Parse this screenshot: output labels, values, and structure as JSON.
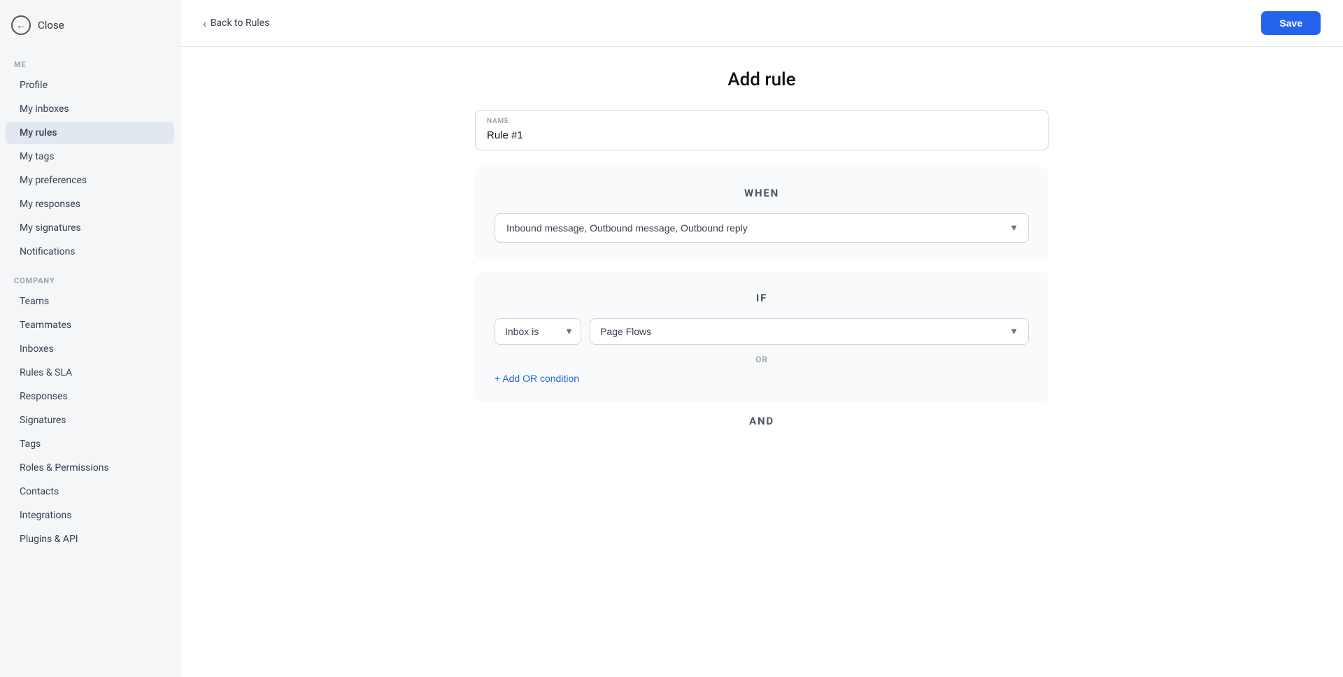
{
  "sidebar": {
    "close_label": "Close",
    "me_section": "ME",
    "company_section": "COMPANY",
    "me_items": [
      {
        "id": "profile",
        "label": "Profile",
        "active": false
      },
      {
        "id": "my-inboxes",
        "label": "My inboxes",
        "active": false
      },
      {
        "id": "my-rules",
        "label": "My rules",
        "active": true
      },
      {
        "id": "my-tags",
        "label": "My tags",
        "active": false
      },
      {
        "id": "my-preferences",
        "label": "My preferences",
        "active": false
      },
      {
        "id": "my-responses",
        "label": "My responses",
        "active": false
      },
      {
        "id": "my-signatures",
        "label": "My signatures",
        "active": false
      },
      {
        "id": "notifications",
        "label": "Notifications",
        "active": false
      }
    ],
    "company_items": [
      {
        "id": "teams",
        "label": "Teams",
        "active": false
      },
      {
        "id": "teammates",
        "label": "Teammates",
        "active": false
      },
      {
        "id": "inboxes",
        "label": "Inboxes",
        "active": false
      },
      {
        "id": "rules-sla",
        "label": "Rules & SLA",
        "active": false
      },
      {
        "id": "responses",
        "label": "Responses",
        "active": false
      },
      {
        "id": "signatures",
        "label": "Signatures",
        "active": false
      },
      {
        "id": "tags",
        "label": "Tags",
        "active": false
      },
      {
        "id": "roles-permissions",
        "label": "Roles & Permissions",
        "active": false
      },
      {
        "id": "contacts",
        "label": "Contacts",
        "active": false
      },
      {
        "id": "integrations",
        "label": "Integrations",
        "active": false
      },
      {
        "id": "plugins-api",
        "label": "Plugins & API",
        "active": false
      }
    ]
  },
  "topbar": {
    "back_label": "Back to Rules",
    "save_label": "Save"
  },
  "main": {
    "page_title": "Add rule",
    "name_label": "NAME",
    "name_placeholder": "Rule #1",
    "name_value": "Rule #1",
    "when_section": {
      "heading": "WHEN",
      "dropdown_value": "Inbound message, Outbound message, Outbound reply",
      "options": [
        "Inbound message, Outbound message, Outbound reply",
        "Inbound message",
        "Outbound message",
        "Outbound reply"
      ]
    },
    "if_section": {
      "heading": "IF",
      "condition_type": "Inbox is",
      "condition_value": "Page Flows",
      "or_label": "OR",
      "add_or_label": "+ Add OR condition",
      "and_label": "AND"
    }
  }
}
